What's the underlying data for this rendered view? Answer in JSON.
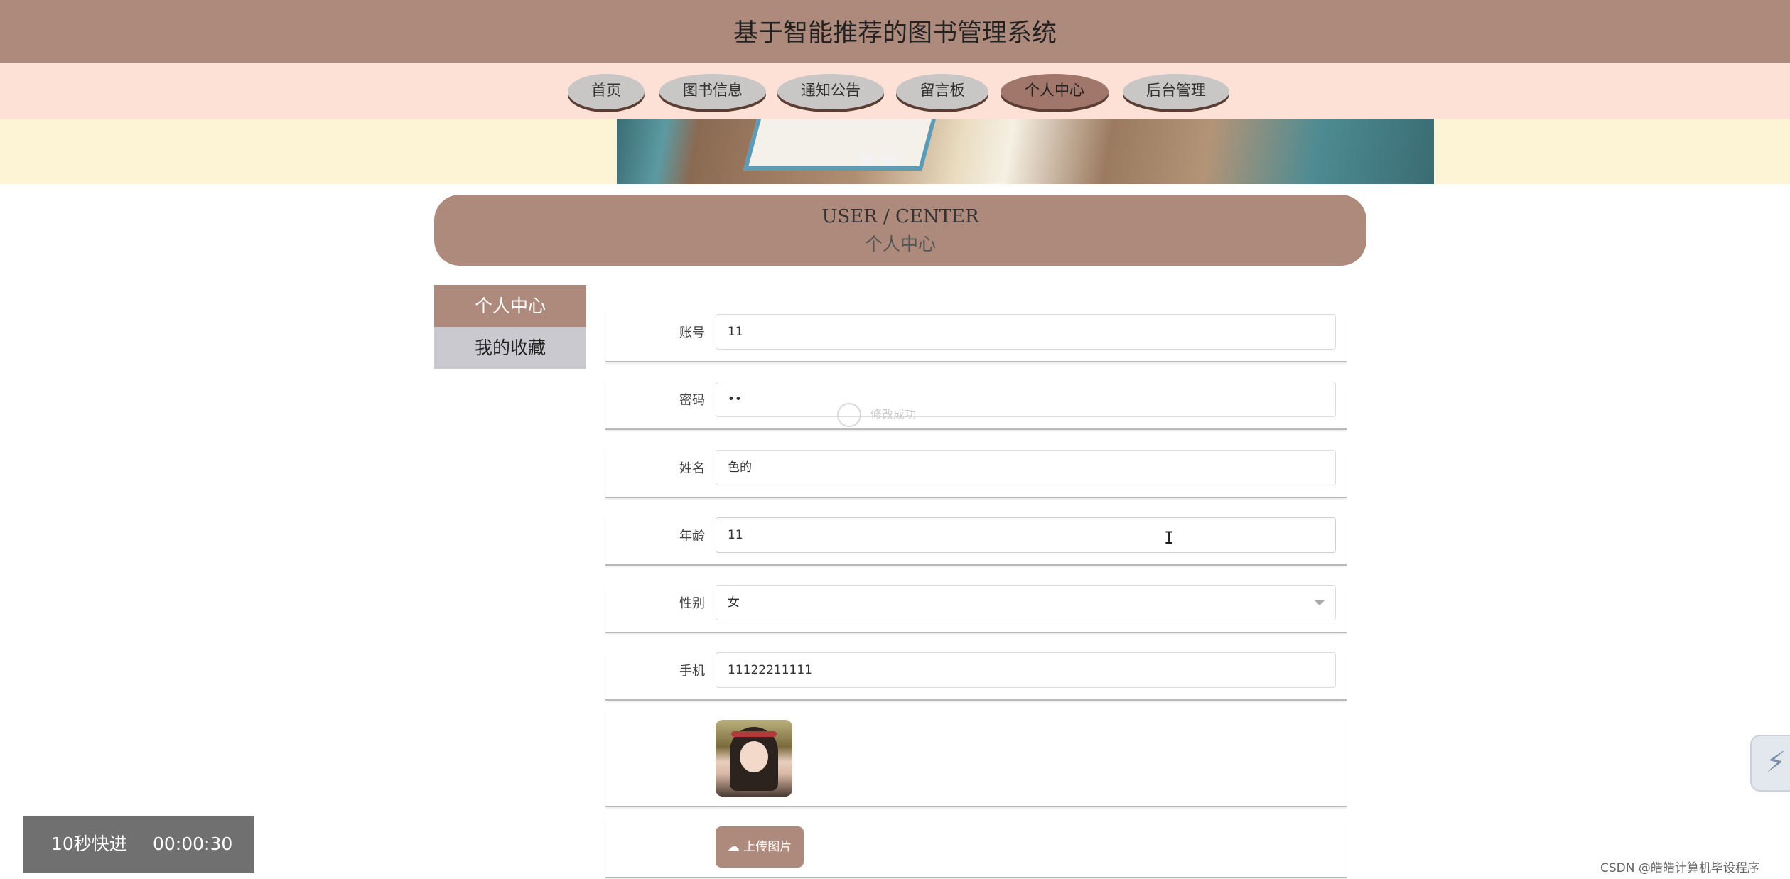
{
  "header": {
    "title": "基于智能推荐的图书管理系统"
  },
  "nav": {
    "items": [
      {
        "label": "首页"
      },
      {
        "label": "图书信息"
      },
      {
        "label": "通知公告"
      },
      {
        "label": "留言板"
      },
      {
        "label": "个人中心",
        "active": true
      },
      {
        "label": "后台管理"
      }
    ]
  },
  "section": {
    "title_en": "USER / CENTER",
    "title_cn": "个人中心"
  },
  "sidebar": {
    "items": [
      {
        "label": "个人中心",
        "active": true
      },
      {
        "label": "我的收藏"
      }
    ]
  },
  "form": {
    "account": {
      "label": "账号",
      "value": "11"
    },
    "password": {
      "label": "密码",
      "value": "••"
    },
    "name": {
      "label": "姓名",
      "value": "色的"
    },
    "age": {
      "label": "年龄",
      "value": "11"
    },
    "gender": {
      "label": "性别",
      "value": "女"
    },
    "phone": {
      "label": "手机",
      "value": "11122211111"
    },
    "upload_label": "上传图片"
  },
  "toast": {
    "text": "修改成功"
  },
  "player": {
    "fast_forward": "10秒快进",
    "time": "00:00:30"
  },
  "watermark": "CSDN @皓皓计算机毕设程序",
  "colors": {
    "primary": "#ae8a7c",
    "nav_bg": "#fde0d6",
    "banner_bg": "#fdf4d6"
  }
}
